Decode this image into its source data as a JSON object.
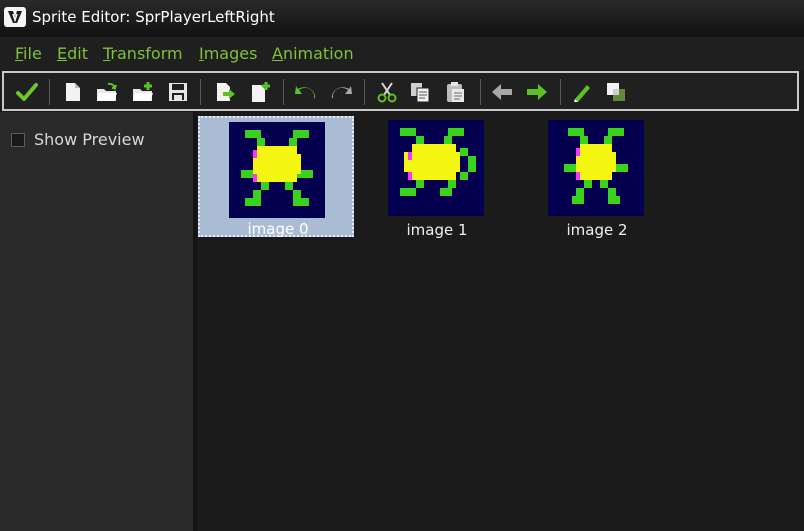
{
  "window": {
    "title": "Sprite Editor: SprPlayerLeftRight",
    "icon": "gamemaker-icon"
  },
  "menu": [
    {
      "mnemonic": "F",
      "rest": "ile"
    },
    {
      "mnemonic": "E",
      "rest": "dit"
    },
    {
      "mnemonic": "T",
      "rest": "ransform"
    },
    {
      "mnemonic": "I",
      "rest": "mages"
    },
    {
      "mnemonic": "A",
      "rest": "nimation"
    }
  ],
  "toolbar_icons": [
    "confirm-check-icon",
    "new-sprite-icon",
    "open-sprite-icon",
    "add-from-file-icon",
    "save-sprite-icon",
    "insert-empty-image-icon",
    "add-empty-image-icon",
    "undo-icon",
    "redo-icon",
    "cut-icon",
    "copy-icon",
    "paste-icon",
    "shift-left-icon",
    "shift-right-icon",
    "edit-image-icon",
    "transparency-icon"
  ],
  "left_panel": {
    "show_preview_label": "Show Preview",
    "show_preview_checked": false
  },
  "images": [
    {
      "label": "image 0",
      "selected": true,
      "pose": "left-right-spread"
    },
    {
      "label": "image 1",
      "selected": false,
      "pose": "leaning-right"
    },
    {
      "label": "image 2",
      "selected": false,
      "pose": "upright"
    }
  ],
  "colors": {
    "menu_text": "#7ec13b",
    "accent_green": "#5cc122",
    "sprite_background": "#04004f",
    "sprite_body": "#f4f510",
    "sprite_legs": "#39d31f",
    "sprite_spot": "#ff33ff",
    "selection": "#a9bcd3"
  }
}
